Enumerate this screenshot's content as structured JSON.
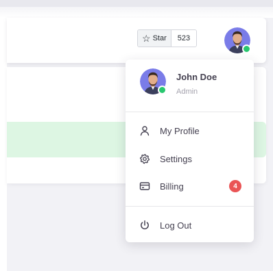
{
  "github": {
    "star_label": "Star",
    "star_count": "523"
  },
  "user": {
    "name": "John Doe",
    "role": "Admin",
    "status": "online",
    "avatar_icon": "user-avatar-photo"
  },
  "menu": {
    "items": [
      {
        "label": "My Profile",
        "icon": "user-icon"
      },
      {
        "label": "Settings",
        "icon": "gear-icon"
      },
      {
        "label": "Billing",
        "icon": "credit-card-icon",
        "badge": "4"
      }
    ],
    "logout": {
      "label": "Log Out",
      "icon": "power-icon"
    }
  },
  "colors": {
    "status_online": "#28c76f",
    "badge": "#ea5455",
    "alert_success_bg": "#ddf6e3",
    "avatar_bg": "#7a7ce8"
  }
}
